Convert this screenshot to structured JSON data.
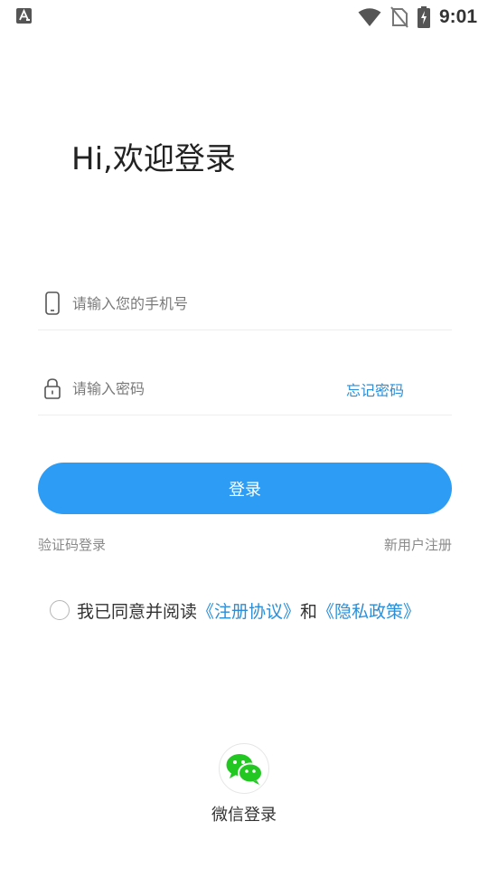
{
  "status_bar": {
    "left_icon": "a-letter-icon",
    "time": "9:01",
    "icons": [
      "wifi-icon",
      "no-sim-icon",
      "battery-charging-icon"
    ]
  },
  "login": {
    "title": "Hi,欢迎登录",
    "phone_placeholder": "请输入您的手机号",
    "password_placeholder": "请输入密码",
    "forgot_password": "忘记密码",
    "login_button": "登录",
    "sms_login": "验证码登录",
    "register": "新用户注册"
  },
  "agreement": {
    "prefix": "我已同意并阅读",
    "terms": "《注册协议》",
    "and": "和",
    "privacy": "《隐私政策》",
    "checked": false
  },
  "wechat": {
    "label": "微信登录",
    "icon": "wechat-icon"
  },
  "colors": {
    "accent": "#2d9cf4",
    "link": "#2a8fd8",
    "wechat_green": "#22c722"
  }
}
